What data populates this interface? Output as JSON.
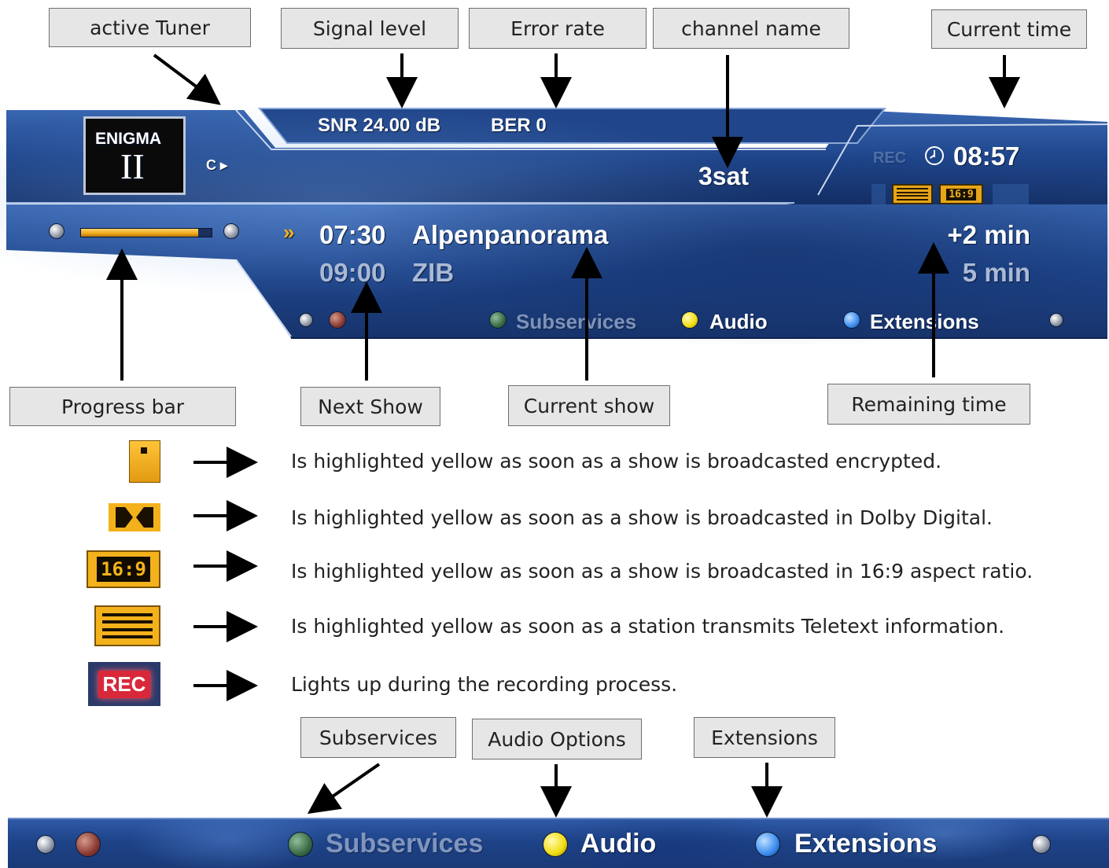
{
  "callouts": {
    "active_tuner": "active Tuner",
    "signal_level": "Signal level",
    "error_rate": "Error rate",
    "channel_name": "channel name",
    "current_time": "Current time",
    "progress_bar": "Progress bar",
    "next_show": "Next Show",
    "current_show": "Current show",
    "remaining_time": "Remaining time",
    "subservices": "Subservices",
    "audio_options": "Audio Options",
    "extensions": "Extensions"
  },
  "osd": {
    "logo_top": "ENIGMA",
    "logo_bottom": "II",
    "tuner": "C ▸",
    "snr": "SNR 24.00 dB",
    "ber": "BER 0",
    "channel": "3sat",
    "rec": "REC",
    "clock_icon": "clock-icon",
    "time": "08:57",
    "aspect_badge": "16:9",
    "progress": 0.9,
    "current_marker": "»",
    "current_time": "07:30",
    "current_title": "Alpenpanorama",
    "current_remaining": "+2 min",
    "next_time": "09:00",
    "next_title": "ZIB",
    "next_duration": "5 min",
    "buttons": {
      "subservices": "Subservices",
      "audio": "Audio",
      "extensions": "Extensions"
    }
  },
  "legend": {
    "encrypted": "Is highlighted yellow as soon as a show is broadcasted encrypted.",
    "dolby": "Is highlighted yellow as soon as a show is broadcasted in Dolby Digital.",
    "aspect": "Is highlighted yellow as soon as a show is broadcasted in 16:9 aspect ratio.",
    "teletext": "Is highlighted yellow as soon as a station transmits Teletext information.",
    "rec": "Lights up during the recording process.",
    "aspect_icon_label": "16:9",
    "rec_icon_label": "REC"
  },
  "bottom_bar": {
    "subservices": "Subservices",
    "audio": "Audio",
    "extensions": "Extensions"
  },
  "colors": {
    "osd_blue": "#1e4388",
    "accent_yellow": "#f3b21c",
    "rec_red": "#d8283a",
    "green_button": "#3a6b45",
    "yellow_button": "#f2dc10",
    "blue_button": "#3a8cf0",
    "red_button": "#8a3a32"
  }
}
